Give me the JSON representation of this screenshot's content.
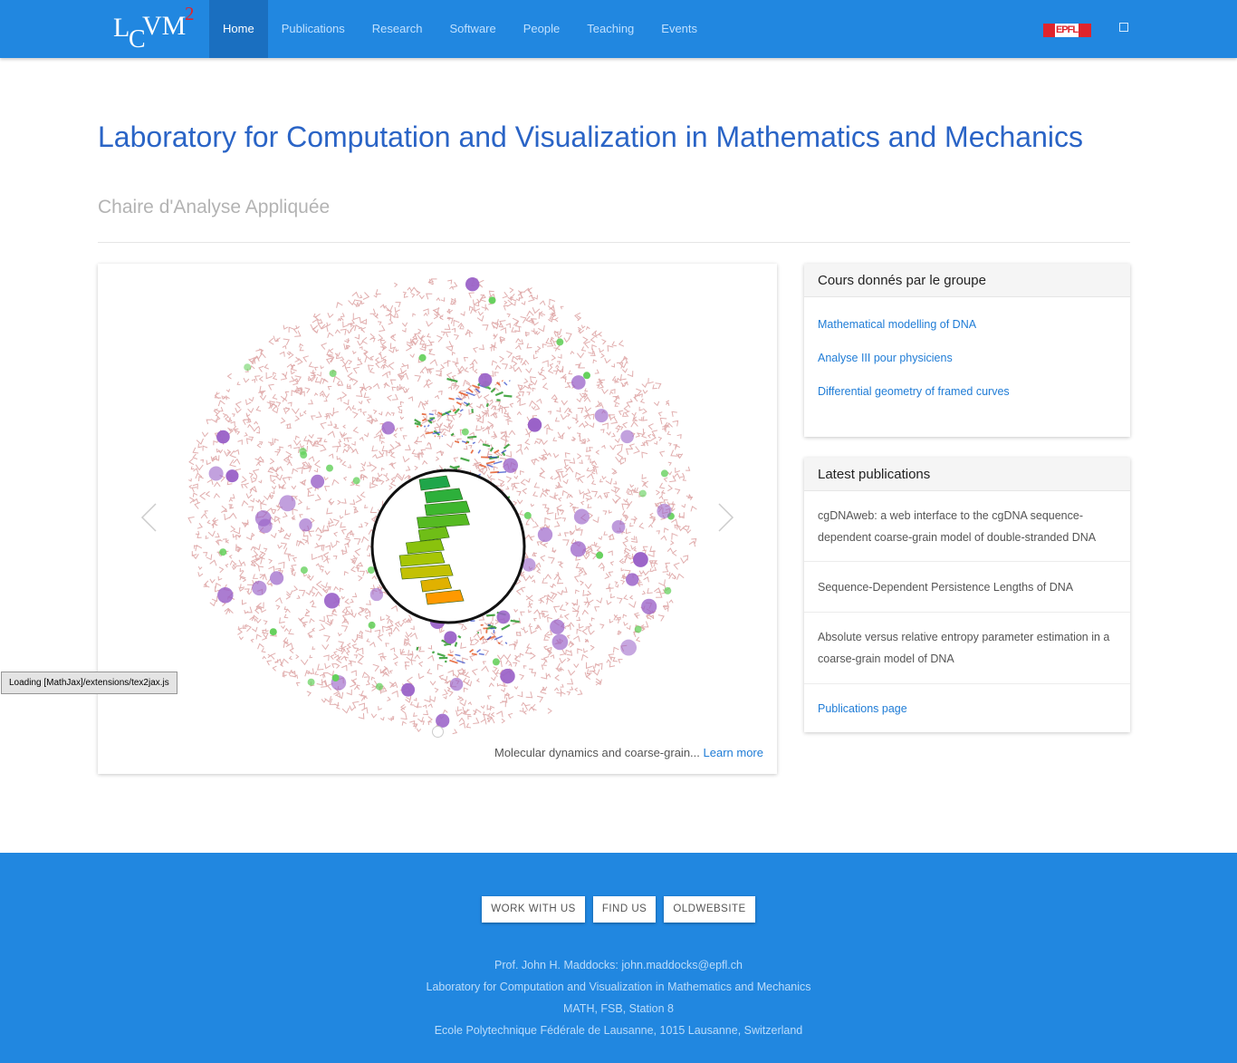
{
  "nav": {
    "logo": {
      "l": "L",
      "c": "C",
      "vm": "VM",
      "sup": "2"
    },
    "items": [
      "Home",
      "Publications",
      "Research",
      "Software",
      "People",
      "Teaching",
      "Events"
    ],
    "active_index": 0,
    "epfl_logo_text": "EPFL",
    "language_icon": "language-icon",
    "colors": {
      "bar": "#2187e0",
      "active": "#1a6fc0"
    }
  },
  "header": {
    "title": "Laboratory for Computation and Visualization in Mathematics and Mechanics",
    "subtitle": "Chaire d'Analyse Appliquée"
  },
  "carousel": {
    "caption_text": "Molecular dynamics and coarse-grain...",
    "caption_link": "Learn more",
    "prev_icon": "chevron-left-icon",
    "next_icon": "chevron-right-icon"
  },
  "courses": {
    "heading": "Cours donnés par le groupe",
    "items": [
      "Mathematical modelling of DNA",
      "Analyse III pour physiciens",
      "Differential geometry of framed curves"
    ]
  },
  "publications": {
    "heading": "Latest publications",
    "items": [
      "cgDNAweb: a web interface to the cgDNA sequence-dependent coarse-grain model of double-stranded DNA",
      "Sequence-Dependent Persistence Lengths of DNA",
      "Absolute versus relative entropy parameter estimation in a coarse-grain model of DNA"
    ],
    "page_link": "Publications page"
  },
  "mathjax_notice": "Loading [MathJax]/extensions/tex2jax.js",
  "footer": {
    "buttons": [
      "WORK WITH US",
      "FIND US",
      "OLDWEBSITE"
    ],
    "lines": [
      "Prof. John H. Maddocks: john.maddocks@epfl.ch",
      "Laboratory for Computation and Visualization in Mathematics and Mechanics",
      "MATH, FSB, Station 8",
      "Ecole Polytechnique Fédérale de Lausanne, 1015 Lausanne, Switzerland"
    ]
  }
}
